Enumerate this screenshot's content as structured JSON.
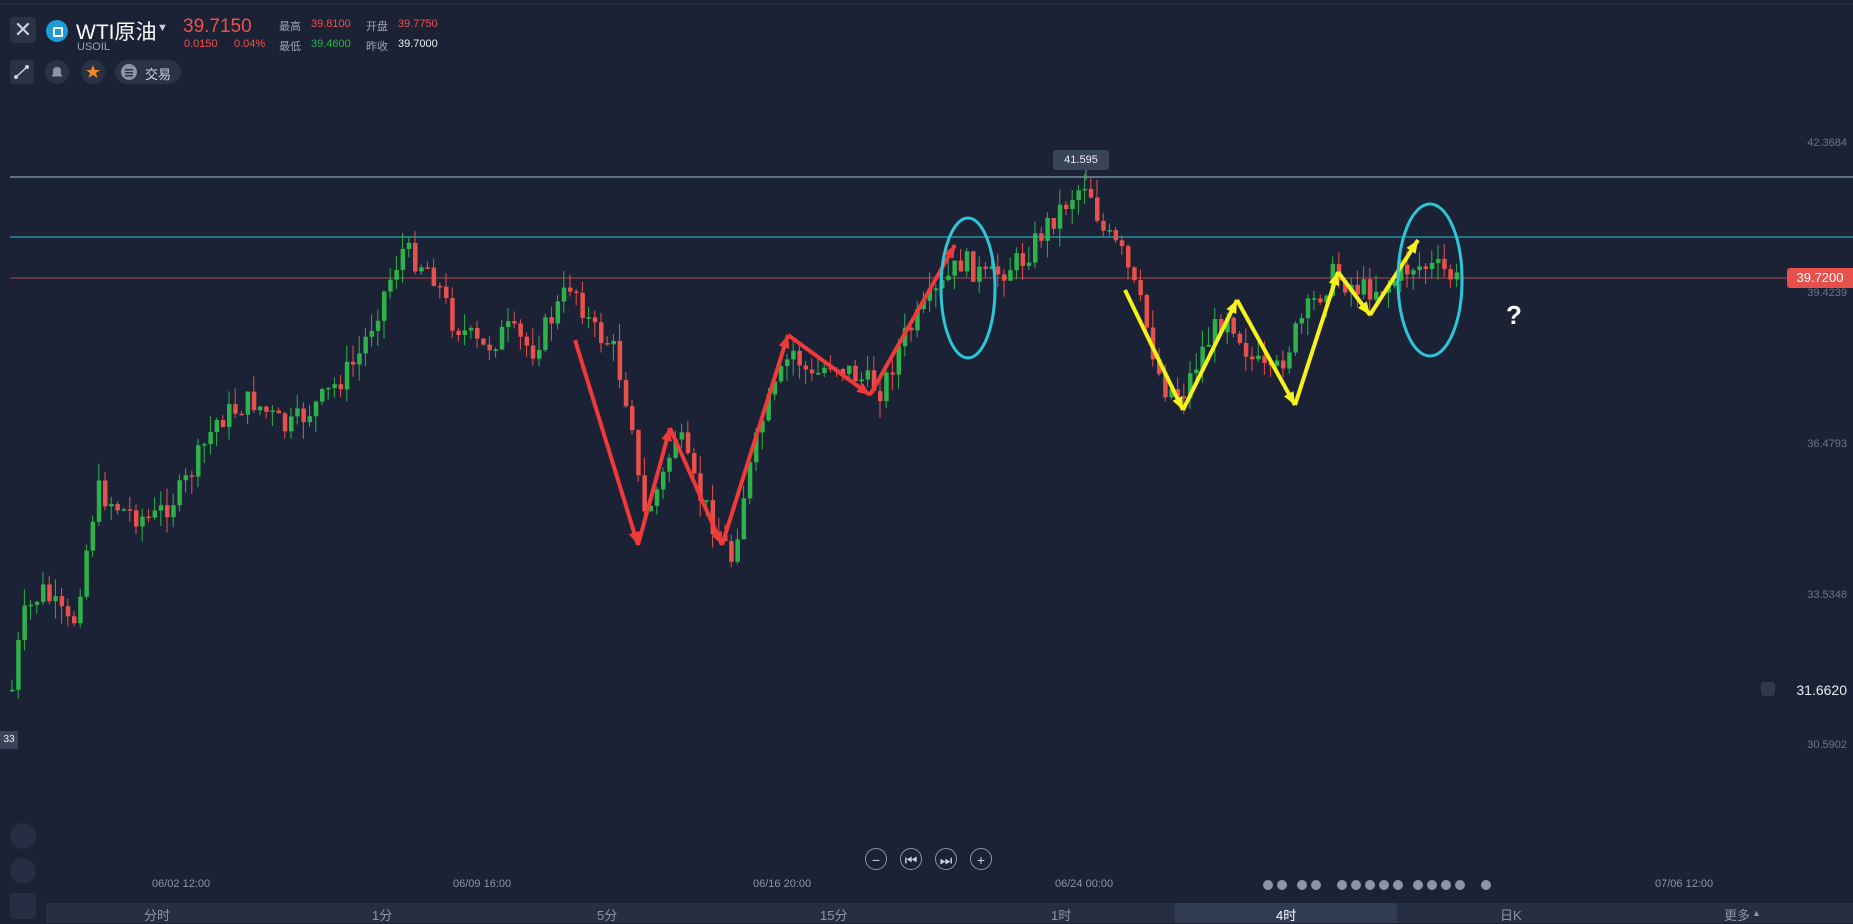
{
  "header": {
    "symbol": "WTI原油",
    "ticker": "USOIL",
    "price": "39.7150",
    "change": "0.0150",
    "change_pct": "0.04%",
    "stats": {
      "high_label": "最高",
      "high_value": "39.8100",
      "open_label": "开盘",
      "open_value": "39.7750",
      "low_label": "最低",
      "low_value": "39.4600",
      "prev_close_label": "昨收",
      "prev_close_value": "39.7000"
    },
    "trade_label": "交易"
  },
  "chart_data": {
    "type": "candlestick",
    "yaxis_ticks": [
      "42.3684",
      "39.4239",
      "36.4793",
      "33.5348",
      "30.5902"
    ],
    "xaxis_ticks": [
      "06/02 12:00",
      "06/09 16:00",
      "06/16 20:00",
      "06/24 00:00",
      "07/06 12:00"
    ],
    "current_price_tag": "39.7200",
    "alert_price": "31.6620",
    "high_marker": "41.595",
    "left_marker": "33",
    "annotation_text": "?",
    "colors": {
      "up": "#2fb14a",
      "down": "#e8504b",
      "arrow_red": "#f03a3a",
      "arrow_yellow": "#f7f21a",
      "circle": "#2cc6d6"
    }
  },
  "timeframes": [
    "分时",
    "1分",
    "5分",
    "15分",
    "1时",
    "4时",
    "日K",
    "更多"
  ],
  "active_timeframe": "4时"
}
